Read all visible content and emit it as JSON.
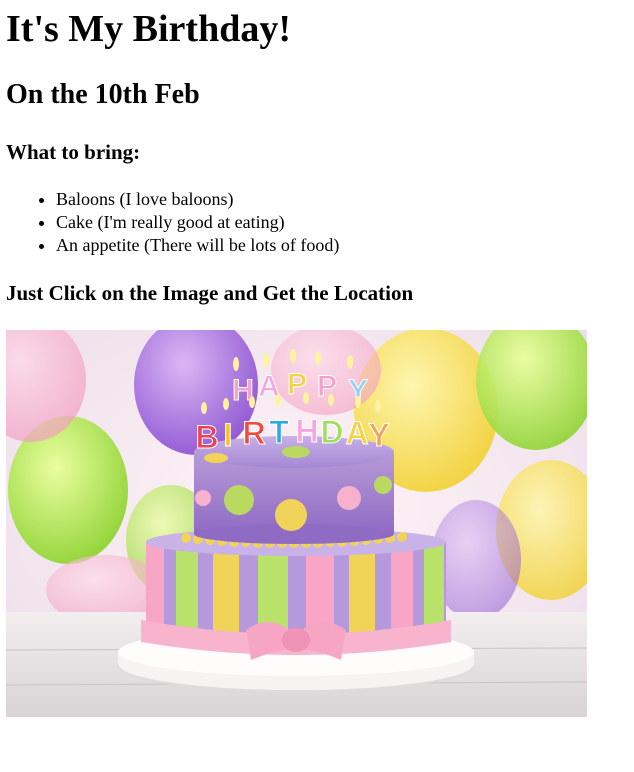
{
  "page": {
    "title": "It's My Birthday!",
    "date_heading": "On the 10th Feb",
    "bring_heading": "What to bring:",
    "bring_items": [
      "Baloons (I love baloons)",
      "Cake (I'm really good at eating)",
      "An appetite (There will be lots of food)"
    ],
    "location_heading": "Just Click on the Image and Get the Location"
  },
  "image": {
    "description_icon": "birthday-cake-image",
    "candle_letters": [
      "H",
      "A",
      "P",
      "P",
      "Y",
      "B",
      "I",
      "R",
      "T",
      "H",
      "D",
      "A",
      "Y"
    ]
  }
}
